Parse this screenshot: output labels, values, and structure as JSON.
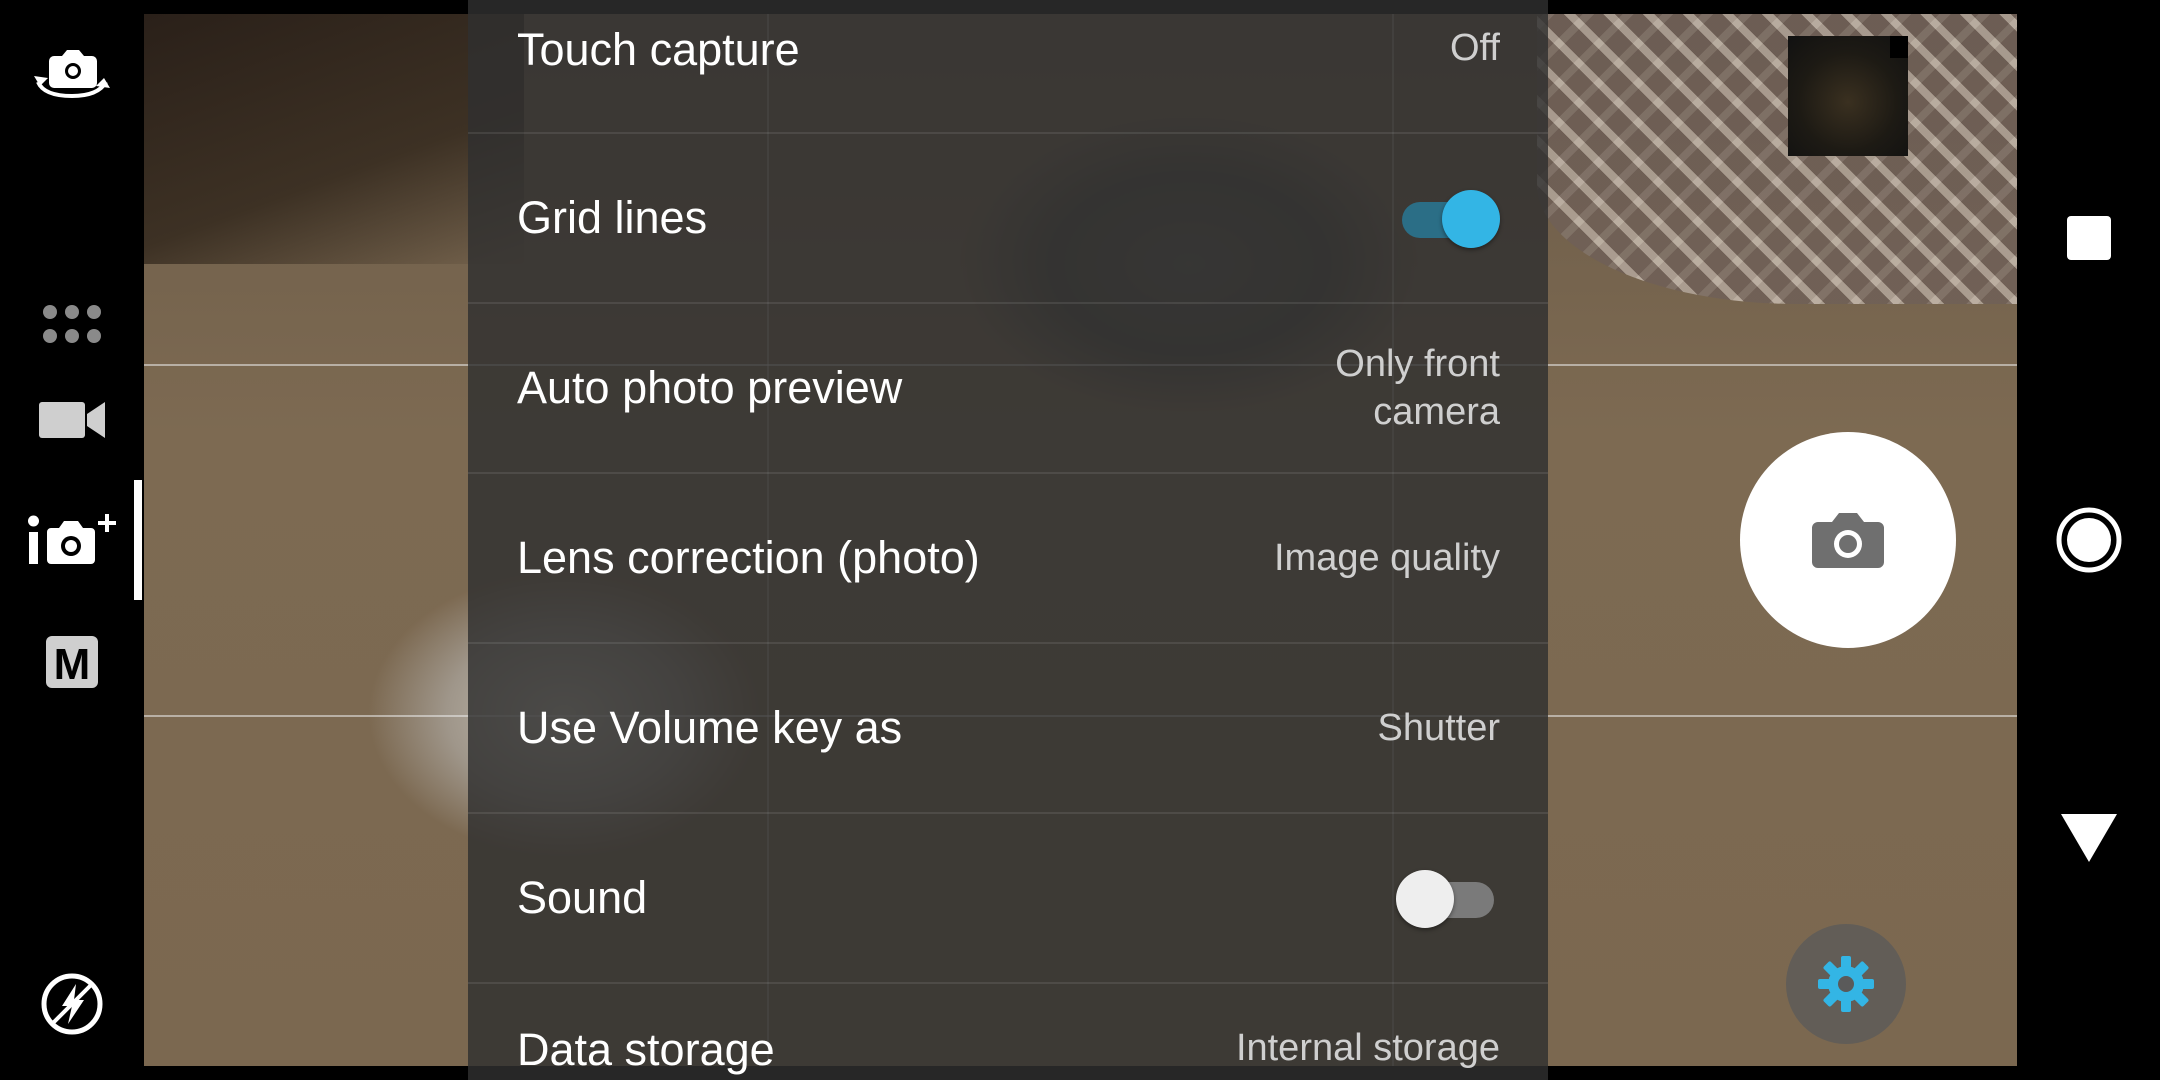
{
  "left_rail": {
    "icons": [
      "switch-camera-icon",
      "more-modes-icon",
      "video-mode-icon",
      "superior-auto-mode-icon",
      "manual-mode-icon",
      "flash-auto-icon"
    ],
    "manual_mode_letter": "M"
  },
  "settings": {
    "rows": [
      {
        "label": "Touch capture",
        "value": "Off"
      },
      {
        "label": "Grid lines",
        "toggle": true
      },
      {
        "label": "Auto photo preview",
        "value_line1": "Only front",
        "value_line2": "camera"
      },
      {
        "label": "Lens correction (photo)",
        "value": "Image quality"
      },
      {
        "label": "Use Volume key as",
        "value": "Shutter"
      },
      {
        "label": "Sound",
        "toggle": false
      },
      {
        "label": "Data storage",
        "value": "Internal storage"
      }
    ]
  },
  "controls": {
    "shutter_icon": "camera-icon",
    "settings_icon": "gear-icon",
    "accent_color": "#33b5e5"
  },
  "nav_bar": {
    "icons": [
      "recents-icon",
      "home-icon",
      "back-icon"
    ]
  }
}
